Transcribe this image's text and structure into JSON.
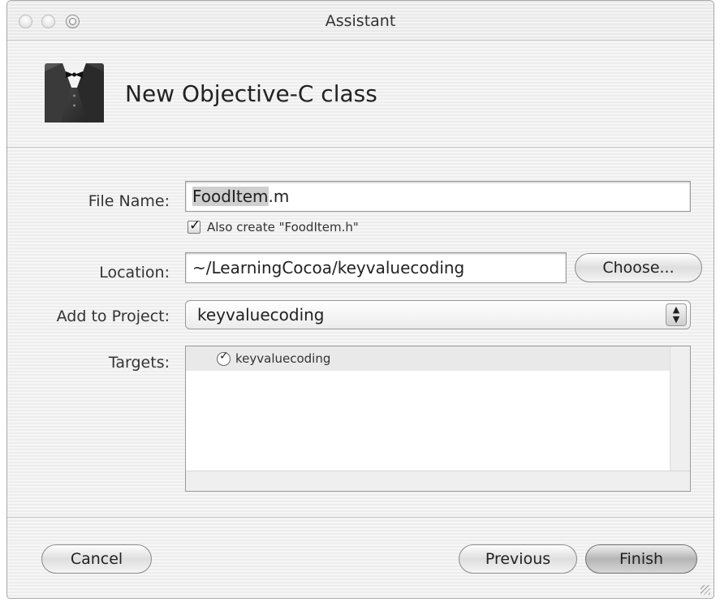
{
  "window": {
    "title": "Assistant"
  },
  "header": {
    "title": "New Objective-C class",
    "icon": "tuxedo-icon"
  },
  "form": {
    "file_name_label": "File Name:",
    "file_name_selected": "FoodItem",
    "file_name_ext": ".m",
    "also_create_label": "Also create \"FoodItem.h\"",
    "also_create_checked": true,
    "location_label": "Location:",
    "location_value": "~/LearningCocoa/keyvaluecoding",
    "choose_label": "Choose...",
    "add_to_project_label": "Add to Project:",
    "project_value": "keyvaluecoding",
    "targets_label": "Targets:",
    "targets": [
      {
        "name": "keyvaluecoding",
        "checked": true
      }
    ]
  },
  "footer": {
    "cancel_label": "Cancel",
    "previous_label": "Previous",
    "finish_label": "Finish"
  }
}
